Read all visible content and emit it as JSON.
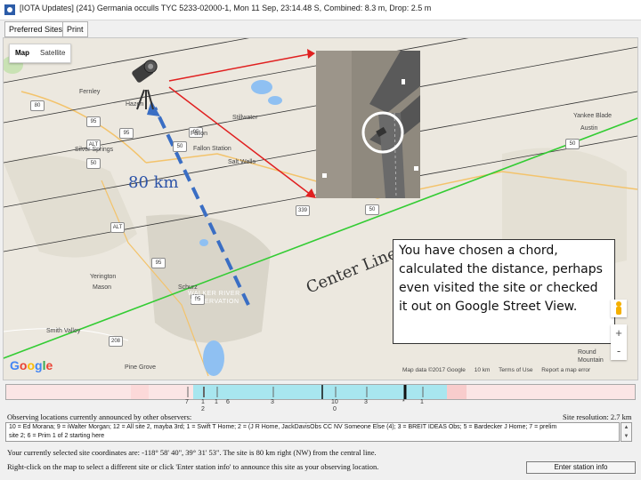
{
  "window": {
    "title": "[IOTA Updates] (241) Germania occulls TYC 5233-02000-1, Mon 11 Sep, 23:14.48 S, Combined: 8.3 m, Drop: 2.5 m"
  },
  "toolbar": {
    "preferred_sites": "Preferred Sites",
    "print": "Print"
  },
  "map": {
    "type_map": "Map",
    "type_satellite": "Satellite",
    "places": {
      "fernley": "Fernley",
      "hazen": "Hazen",
      "stillwater": "Stillwater",
      "fallon": "Fallon",
      "fallon_station": "Fallon Station",
      "silver_springs": "Silver Springs",
      "salt_wells": "Salt Wells",
      "yerington": "Yerington",
      "mason": "Mason",
      "schurz": "Schurz",
      "smith_valley": "Smith Valley",
      "pine_grove": "Pine Grove",
      "walker_river_1": "WALKER RIVER",
      "walker_river_2": "RESERVATION",
      "yankee_blade": "Yankee Blade",
      "austin": "Austin",
      "round_mountain_1": "Round",
      "round_mountain_2": "Mountain"
    },
    "shields": [
      "80",
      "95",
      "50",
      "95",
      "50",
      "95",
      "95",
      "339",
      "95",
      "50",
      "ALT",
      "ALT",
      "50",
      "208"
    ],
    "distance_label": "80 km",
    "center_line_label": "Center Line",
    "google_logo": "Google",
    "attribution": {
      "data": "Map data ©2017 Google",
      "scale": "10 km",
      "terms": "Terms of Use",
      "report": "Report a map error"
    },
    "zoom_in": "+",
    "zoom_out": "-"
  },
  "callout": {
    "text": "You have chosen a chord, calculated the distance, perhaps even visited the site or checked it out on Google Street View."
  },
  "timeline": {
    "labels": [
      "7",
      "1",
      "1",
      "6",
      "3",
      "10",
      "3",
      "*",
      "1"
    ],
    "sub_labels": [
      "2",
      "0"
    ]
  },
  "panel": {
    "observing_header": "Observing locations currently announced by other observers:",
    "site_resolution": "Site resolution: 2.7 km",
    "observers_line1": "10 = Ed Morana; 9 = iWalter Morgan; 12 = All site 2, mayba 3rd; 1 = Swift T Home; 2 = (J R Home, JackDavisObs CC NV Someone Else (4); 3 = BREIT IDEAS Obs; 5 = Bardecker J Home; 7 = prelim",
    "observers_line2": "site 2; 6 = Prim 1 of 2 starting here",
    "coordinates": "Your currently selected site coordinates are: -118° 58' 40\", 39° 31' 53\". The site is 80 km right (NW) from the central line.",
    "instructions": "Right-click on the map to select a different site or click 'Enter station info' to announce this site as your observing location.",
    "enter_station": "Enter station info"
  },
  "colors": {
    "arrow_red": "#e02020",
    "dashed_blue": "#3a6ec4",
    "center_line_green": "#33cc33",
    "chord_lines": "#333333",
    "timeline_cyan": "#a8e6ef",
    "timeline_pink": "#fbe5e5"
  }
}
